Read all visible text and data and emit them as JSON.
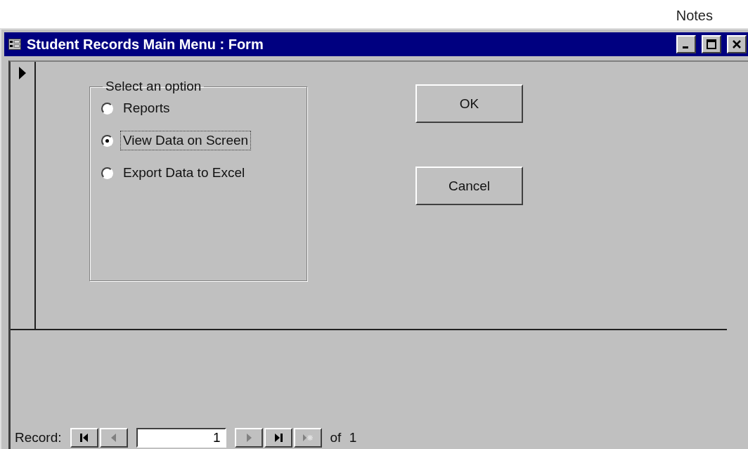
{
  "header": {
    "label": "Notes"
  },
  "window": {
    "title": "Student Records Main Menu : Form"
  },
  "option_group": {
    "label": "Select an option",
    "options": [
      {
        "label": "Reports",
        "selected": false
      },
      {
        "label": "View Data on Screen",
        "selected": true
      },
      {
        "label": "Export Data to Excel",
        "selected": false
      }
    ]
  },
  "buttons": [
    "OK",
    "Cancel"
  ],
  "navigator": {
    "label": "Record:",
    "value": "1",
    "total_label": "of",
    "total": "1",
    "before": [
      {
        "kind": "first",
        "disabled": false
      },
      {
        "kind": "prev",
        "disabled": true
      }
    ],
    "after": [
      {
        "kind": "next",
        "disabled": true
      },
      {
        "kind": "last",
        "disabled": false
      },
      {
        "kind": "new",
        "disabled": true
      }
    ]
  }
}
